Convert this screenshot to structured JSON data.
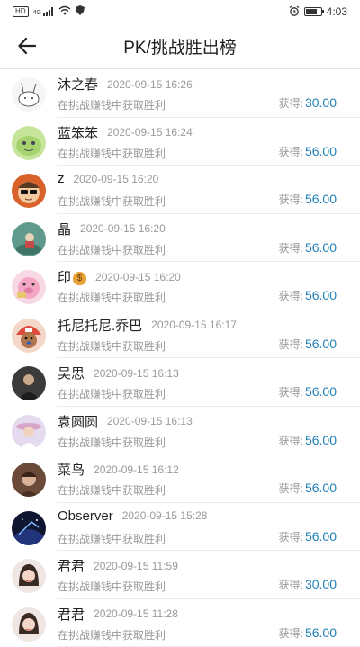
{
  "status_bar": {
    "left_icons": [
      "hd-badge",
      "signal-4g-icon",
      "wifi-icon",
      "shield-icon"
    ],
    "hd": "HD",
    "net": "4G",
    "time": "4:03",
    "battery_level": 0.8
  },
  "header": {
    "title": "PK/挑战胜出榜",
    "back_icon": "back-arrow-icon"
  },
  "colors": {
    "accent": "#1e7fb8",
    "muted": "#9a9a9a"
  },
  "records": [
    {
      "name": "沐之春",
      "time": "2020-09-15 16:26",
      "desc": "在挑战赚钱中获取胜利",
      "reward_label": "获得:",
      "reward_value": "30.00",
      "avatar": "rabbit-sketch"
    },
    {
      "name": "蓝笨笨",
      "time": "2020-09-15 16:24",
      "desc": "在挑战赚钱中获取胜利",
      "reward_label": "获得:",
      "reward_value": "56.00",
      "avatar": "green-cartoon"
    },
    {
      "name": "z",
      "time": "2020-09-15 16:20",
      "desc": "在挑战赚钱中获取胜利",
      "reward_label": "获得:",
      "reward_value": "56.00",
      "avatar": "sunglasses-face"
    },
    {
      "name": "晶",
      "time": "2020-09-15 16:20",
      "desc": "在挑战赚钱中获取胜利",
      "reward_label": "获得:",
      "reward_value": "56.00",
      "avatar": "teal-photo"
    },
    {
      "name": "印",
      "has_emoji": true,
      "emoji": "$",
      "time": "2020-09-15 16:20",
      "desc": "在挑战赚钱中获取胜利",
      "reward_label": "获得:",
      "reward_value": "56.00",
      "avatar": "pink-pig"
    },
    {
      "name": "托尼托尼.乔巴",
      "time": "2020-09-15 16:17",
      "desc": "在挑战赚钱中获取胜利",
      "reward_label": "获得:",
      "reward_value": "56.00",
      "avatar": "chopper"
    },
    {
      "name": "吴思",
      "time": "2020-09-15 16:13",
      "desc": "在挑战赚钱中获取胜利",
      "reward_label": "获得:",
      "reward_value": "56.00",
      "avatar": "dark-portrait"
    },
    {
      "name": "袁圆圆",
      "time": "2020-09-15 16:13",
      "desc": "在挑战赚钱中获取胜利",
      "reward_label": "获得:",
      "reward_value": "56.00",
      "avatar": "girl-hat"
    },
    {
      "name": "菜鸟",
      "time": "2020-09-15 16:12",
      "desc": "在挑战赚钱中获取胜利",
      "reward_label": "获得:",
      "reward_value": "56.00",
      "avatar": "brown-portrait"
    },
    {
      "name": "Observer",
      "time": "2020-09-15 15:28",
      "desc": "在挑战赚钱中获取胜利",
      "reward_label": "获得:",
      "reward_value": "56.00",
      "avatar": "night-sky"
    },
    {
      "name": "君君",
      "time": "2020-09-15 11:59",
      "desc": "在挑战赚钱中获取胜利",
      "reward_label": "获得:",
      "reward_value": "30.00",
      "avatar": "woman-portrait"
    },
    {
      "name": "君君",
      "time": "2020-09-15 11:28",
      "desc": "在挑战赚钱中获取胜利",
      "reward_label": "获得:",
      "reward_value": "56.00",
      "avatar": "woman-portrait"
    }
  ]
}
